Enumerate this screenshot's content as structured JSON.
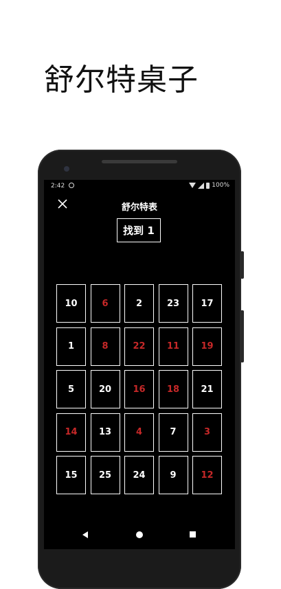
{
  "promo": {
    "title": "舒尔特桌子"
  },
  "status_bar": {
    "time": "2:42",
    "battery": "100%"
  },
  "toolbar": {
    "title": "舒尔特表"
  },
  "target": {
    "label": "找到 1"
  },
  "colors": {
    "white_text": "#ffffff",
    "red_text": "#c62828",
    "background": "#000000"
  },
  "grid": {
    "rows": [
      [
        {
          "n": "10",
          "red": false
        },
        {
          "n": "6",
          "red": true
        },
        {
          "n": "2",
          "red": false
        },
        {
          "n": "23",
          "red": false
        },
        {
          "n": "17",
          "red": false
        }
      ],
      [
        {
          "n": "1",
          "red": false
        },
        {
          "n": "8",
          "red": true
        },
        {
          "n": "22",
          "red": true
        },
        {
          "n": "11",
          "red": true
        },
        {
          "n": "19",
          "red": true
        }
      ],
      [
        {
          "n": "5",
          "red": false
        },
        {
          "n": "20",
          "red": false
        },
        {
          "n": "16",
          "red": true
        },
        {
          "n": "18",
          "red": true
        },
        {
          "n": "21",
          "red": false
        }
      ],
      [
        {
          "n": "14",
          "red": true
        },
        {
          "n": "13",
          "red": false
        },
        {
          "n": "4",
          "red": true
        },
        {
          "n": "7",
          "red": false
        },
        {
          "n": "3",
          "red": true
        }
      ],
      [
        {
          "n": "15",
          "red": false
        },
        {
          "n": "25",
          "red": false
        },
        {
          "n": "24",
          "red": false
        },
        {
          "n": "9",
          "red": false
        },
        {
          "n": "12",
          "red": true
        }
      ]
    ]
  },
  "icons": {
    "close": "close-icon",
    "back": "back-icon",
    "home": "home-icon",
    "recents": "recents-icon"
  }
}
